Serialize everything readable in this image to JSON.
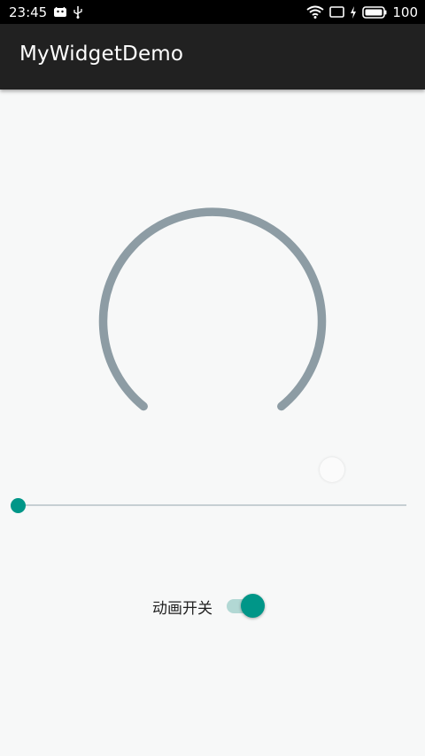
{
  "status_bar": {
    "time": "23:45",
    "battery_level": "100",
    "icons": [
      "android-notification-icon",
      "usb-icon",
      "wifi-icon",
      "screen-cast-icon",
      "charging-icon",
      "battery-icon"
    ]
  },
  "app_bar": {
    "title": "MyWidgetDemo"
  },
  "arc_progress": {
    "color": "#8d9ca4"
  },
  "seek_bar": {
    "progress": 0,
    "thumb_color": "#009688",
    "track_color": "#c6cfd3"
  },
  "animation_switch": {
    "label": "动画开关",
    "checked": true,
    "accent_color": "#009688"
  }
}
